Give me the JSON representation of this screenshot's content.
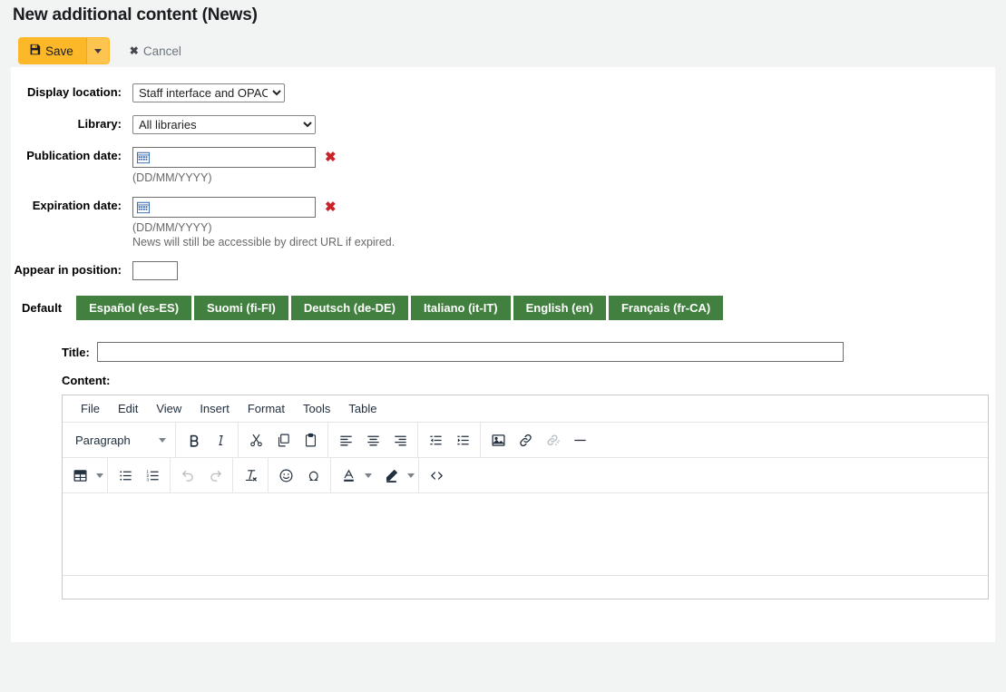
{
  "page": {
    "title": "New additional content (News)"
  },
  "toolbar": {
    "save_label": "Save",
    "save_icon": "floppy-disk-icon",
    "save_caret_icon": "caret-down-icon",
    "cancel_label": "Cancel",
    "cancel_icon": "close-x-icon"
  },
  "form": {
    "display_location": {
      "label": "Display location:",
      "value": "Staff interface and OPAC"
    },
    "library": {
      "label": "Library:",
      "value": "All libraries"
    },
    "publication_date": {
      "label": "Publication date:",
      "value": "",
      "icon": "calendar-icon",
      "clear_icon": "red-x-icon",
      "hint": "(DD/MM/YYYY)"
    },
    "expiration_date": {
      "label": "Expiration date:",
      "value": "",
      "icon": "calendar-icon",
      "clear_icon": "red-x-icon",
      "hint": "(DD/MM/YYYY)",
      "hint2": "News will still be accessible by direct URL if expired."
    },
    "position": {
      "label": "Appear in position:",
      "value": ""
    }
  },
  "tabs": [
    {
      "label": "Default",
      "active": true
    },
    {
      "label": "Español (es-ES)",
      "active": false
    },
    {
      "label": "Suomi (fi-FI)",
      "active": false
    },
    {
      "label": "Deutsch (de-DE)",
      "active": false
    },
    {
      "label": "Italiano (it-IT)",
      "active": false
    },
    {
      "label": "English (en)",
      "active": false
    },
    {
      "label": "Français (fr-CA)",
      "active": false
    }
  ],
  "content": {
    "title_label": "Title:",
    "title_value": "",
    "content_label": "Content:",
    "editor": {
      "menus": [
        "File",
        "Edit",
        "View",
        "Insert",
        "Format",
        "Tools",
        "Table"
      ],
      "block_format": "Paragraph",
      "body_text": "",
      "row1_icons": [
        "bold-icon",
        "italic-icon",
        "cut-icon",
        "copy-icon",
        "paste-icon",
        "align-left-icon",
        "align-center-icon",
        "align-right-icon",
        "outdent-icon",
        "indent-icon",
        "insert-image-icon",
        "insert-link-icon",
        "unlink-icon",
        "horizontal-rule-icon"
      ],
      "row2_icons": [
        "table-icon",
        "bullet-list-icon",
        "numbered-list-icon",
        "undo-icon",
        "redo-icon",
        "clear-formatting-icon",
        "emoticon-icon",
        "special-character-icon",
        "text-color-icon",
        "highlight-color-icon",
        "source-code-icon"
      ]
    }
  },
  "colors": {
    "accent_save": "#fcb828",
    "tab_green": "#41803f",
    "danger_red": "#cb2027",
    "page_bg": "#f2f4f4"
  }
}
